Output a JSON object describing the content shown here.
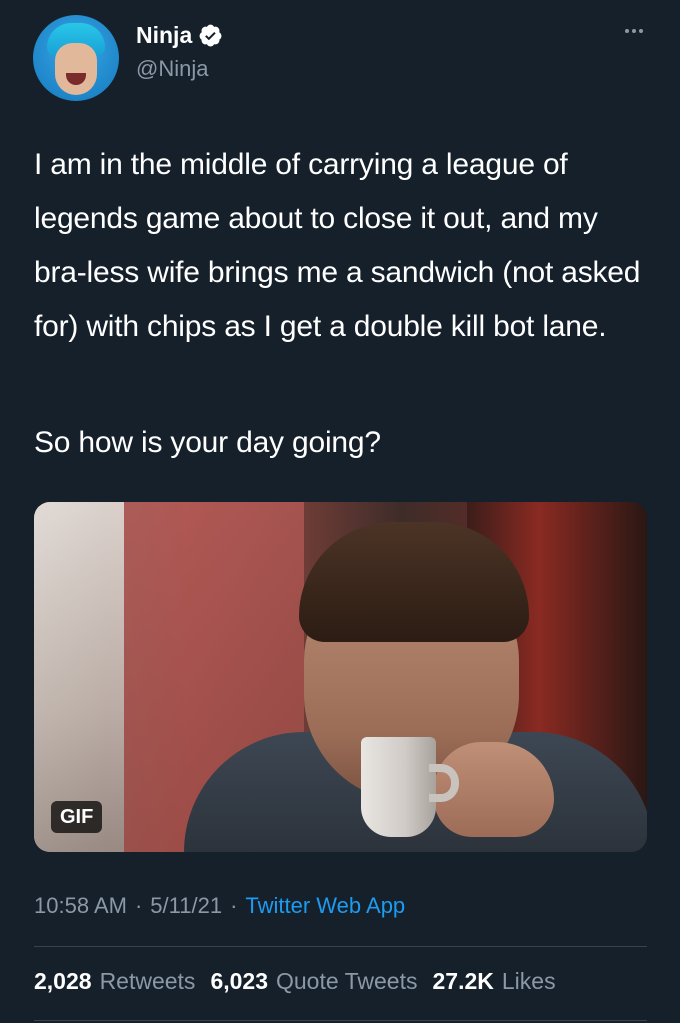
{
  "author": {
    "name": "Ninja",
    "handle": "@Ninja",
    "verified": true,
    "verified_icon": "verified-badge-icon"
  },
  "tweet": {
    "text": "I am in the middle of carrying a league of legends game about to close it out, and my bra-less wife brings me a sandwich (not asked for) with chips as I get a double kill bot lane.",
    "text_line2": "So how is your day going?",
    "media_badge": "GIF"
  },
  "meta": {
    "time": "10:58 AM",
    "separator": "·",
    "date": "5/11/21",
    "source": "Twitter Web App"
  },
  "stats": {
    "retweets_count": "2,028",
    "retweets_label": "Retweets",
    "quotes_count": "6,023",
    "quotes_label": "Quote Tweets",
    "likes_count": "27.2K",
    "likes_label": "Likes"
  },
  "colors": {
    "background": "#15202b",
    "secondary_text": "#8b98a5",
    "link": "#1d9bf0",
    "divider": "#38444d"
  }
}
